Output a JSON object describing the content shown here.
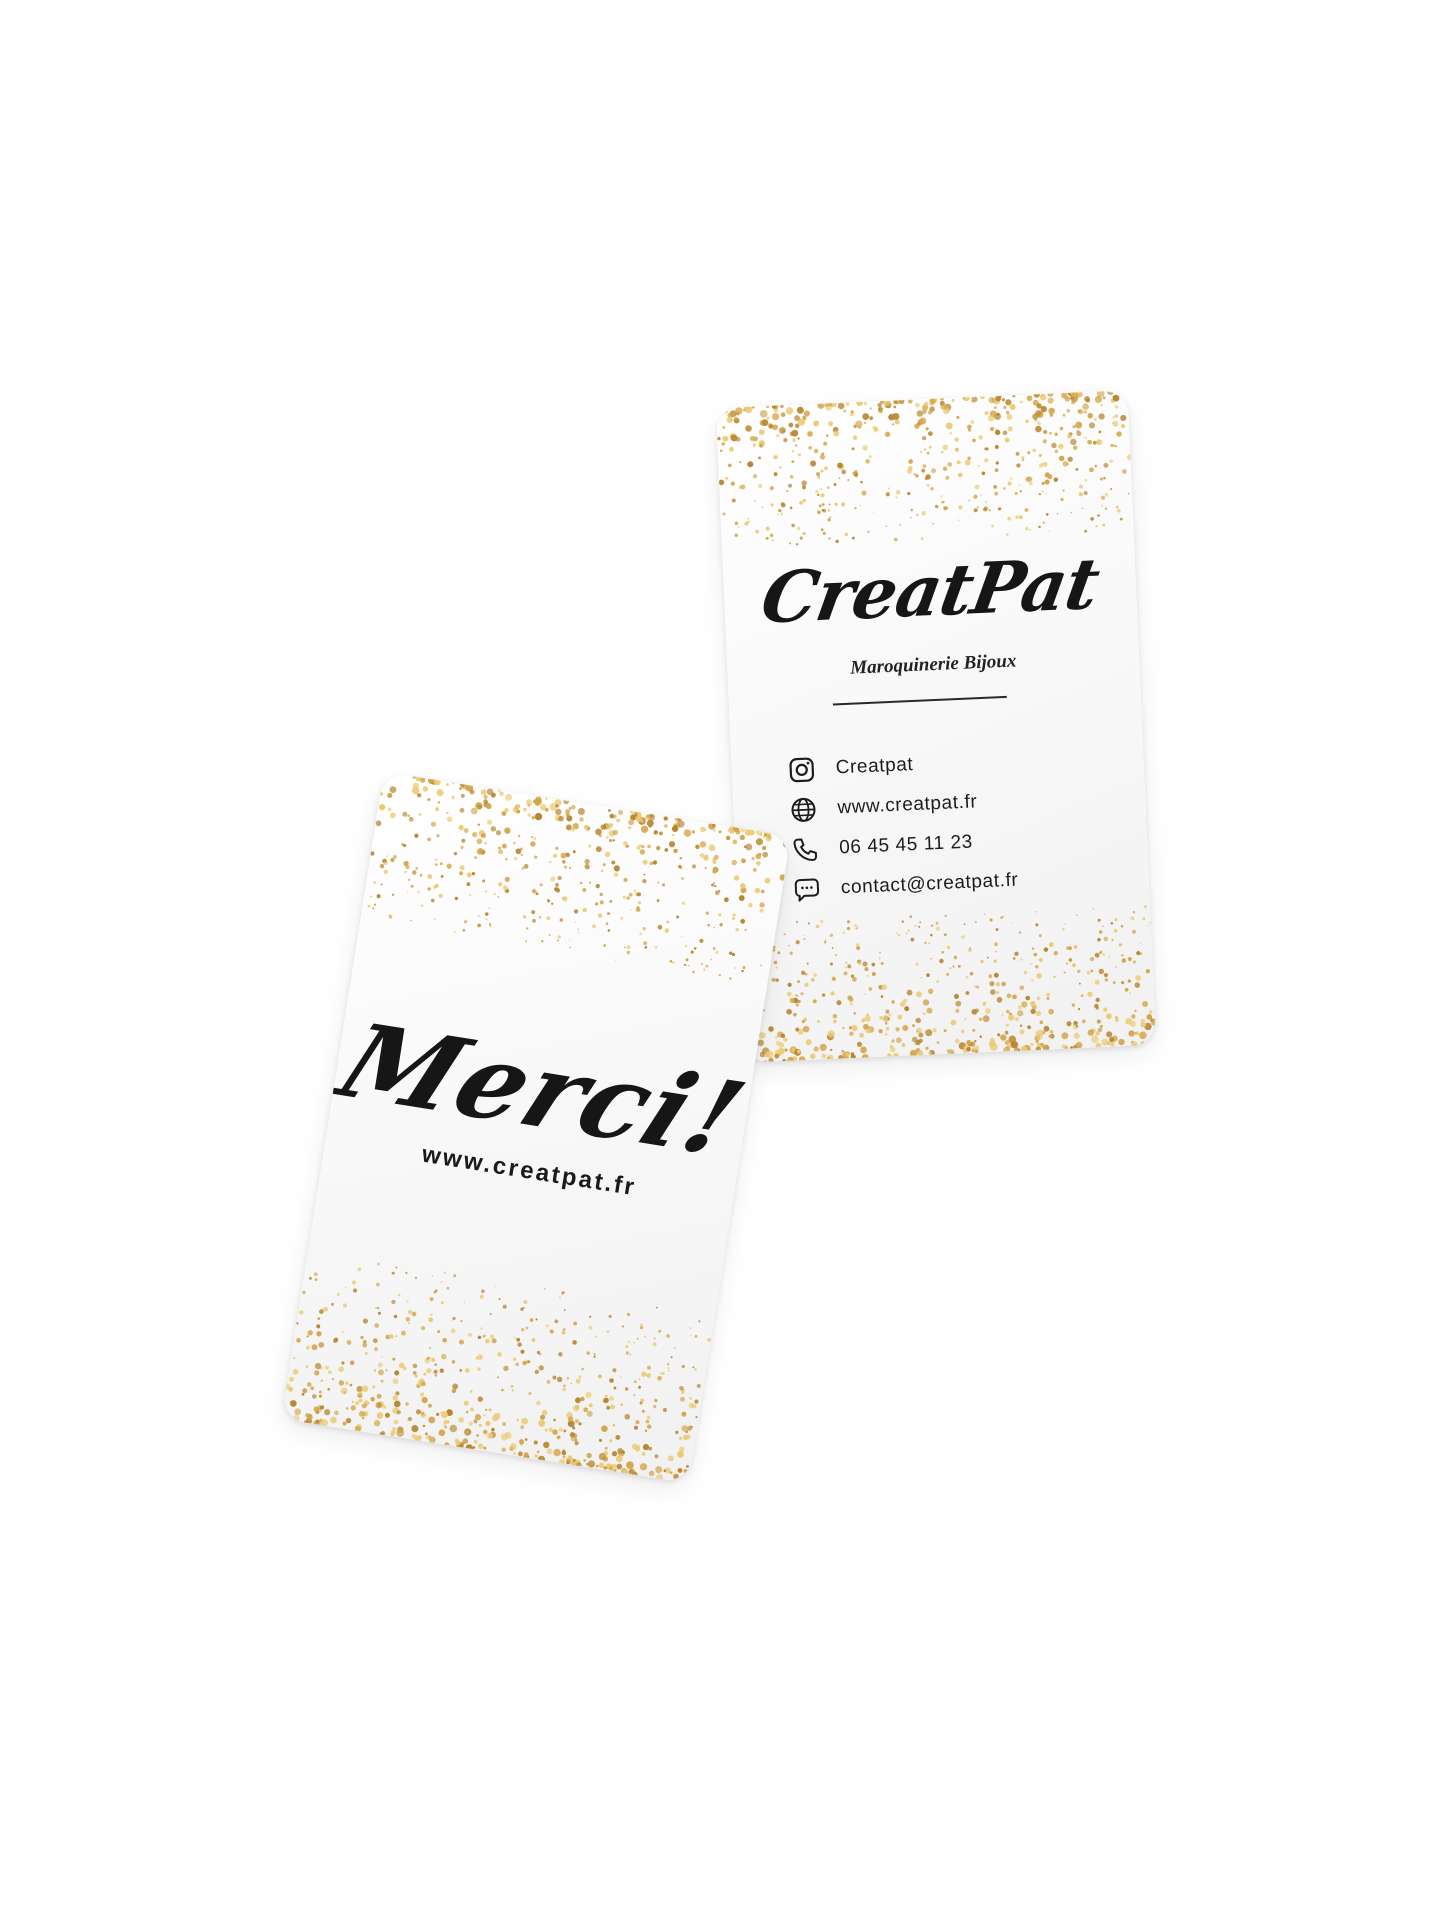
{
  "front_card": {
    "brand_name": "CreatPat",
    "tagline": "Maroquinerie Bijoux",
    "contacts": [
      {
        "icon": "instagram-icon",
        "text": "Creatpat"
      },
      {
        "icon": "globe-icon",
        "text": "www.creatpat.fr"
      },
      {
        "icon": "phone-icon",
        "text": "06 45 45 11 23"
      },
      {
        "icon": "chat-bubble-icon",
        "text": "contact@creatpat.fr"
      }
    ]
  },
  "back_card": {
    "thanks": "Merci!",
    "url": "www.creatpat.fr"
  },
  "colors": {
    "gold": "#d4a64a",
    "gold_light": "#ecca72",
    "gold_dark": "#b8862f",
    "ink": "#161616",
    "card": "#ffffff"
  }
}
